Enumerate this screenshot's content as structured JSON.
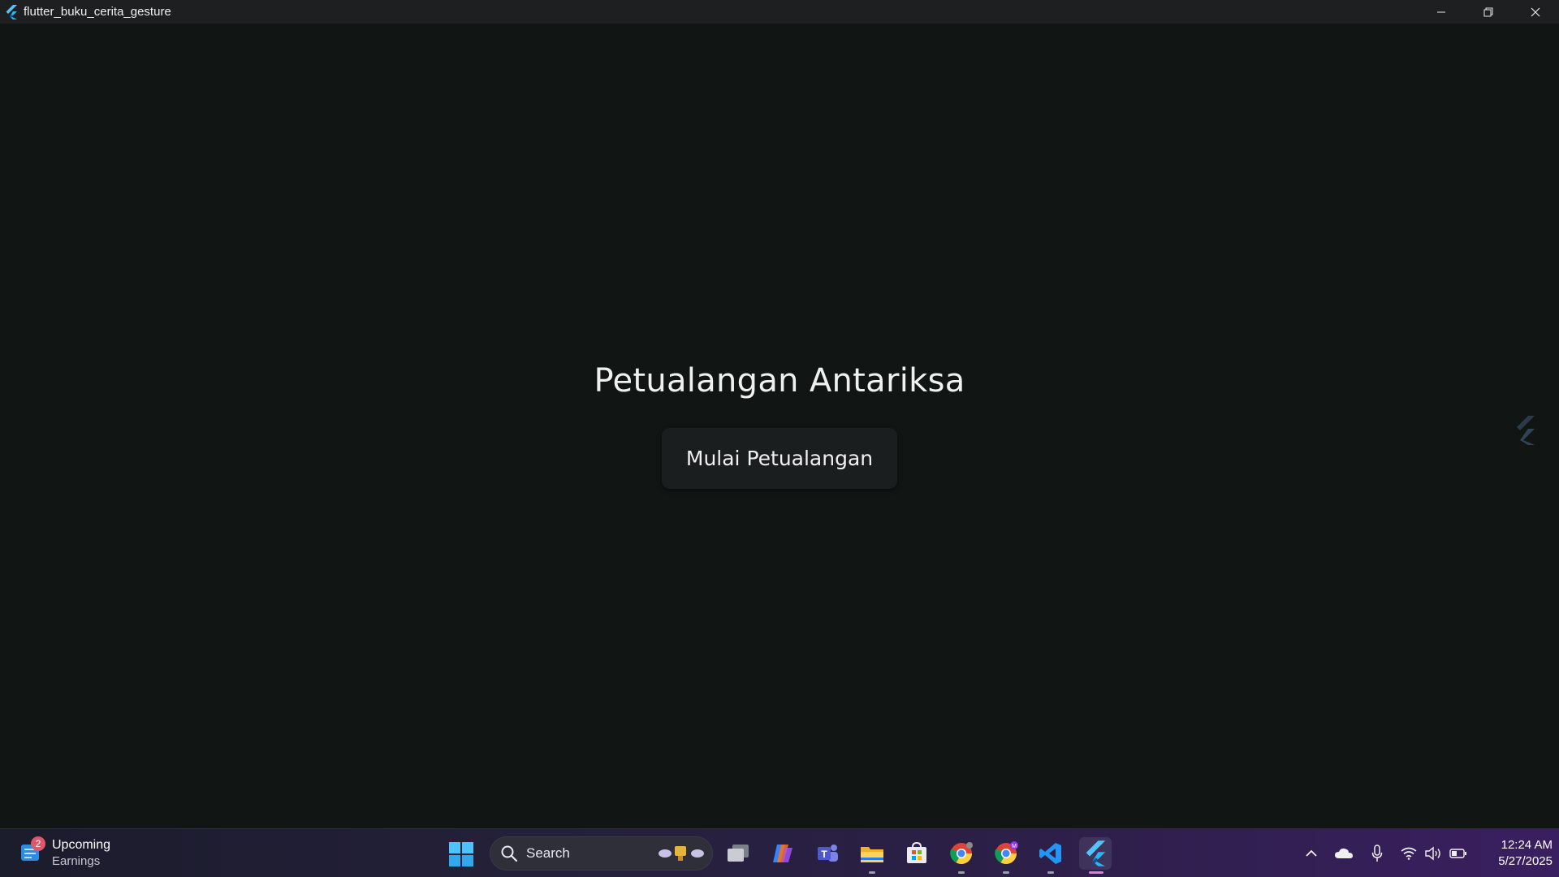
{
  "window": {
    "title": "flutter_buku_cerita_gesture",
    "minimize_label": "Minimize",
    "restore_label": "Restore",
    "close_label": "Close"
  },
  "app": {
    "heading": "Petualangan Antariksa",
    "start_button": "Mulai Petualangan"
  },
  "taskbar": {
    "widget": {
      "badge": "2",
      "line1": "Upcoming",
      "line2": "Earnings"
    },
    "search": {
      "placeholder": "Search"
    },
    "apps": [
      {
        "icon": "task-view-icon"
      },
      {
        "icon": "copilot-icon"
      },
      {
        "icon": "teams-icon"
      },
      {
        "icon": "file-explorer-icon"
      },
      {
        "icon": "microsoft-store-icon"
      },
      {
        "icon": "chrome-icon"
      },
      {
        "icon": "chrome-profile-icon",
        "profile_badge": "M"
      },
      {
        "icon": "vscode-icon"
      },
      {
        "icon": "flutter-app-icon"
      }
    ],
    "clock": {
      "time": "12:24 AM",
      "date": "5/27/2025"
    }
  },
  "colors": {
    "app_background": "#111614",
    "button_background": "#1a1e1e",
    "titlebar": "#1e1f21",
    "flutter_blue": "#4fc3f7"
  }
}
